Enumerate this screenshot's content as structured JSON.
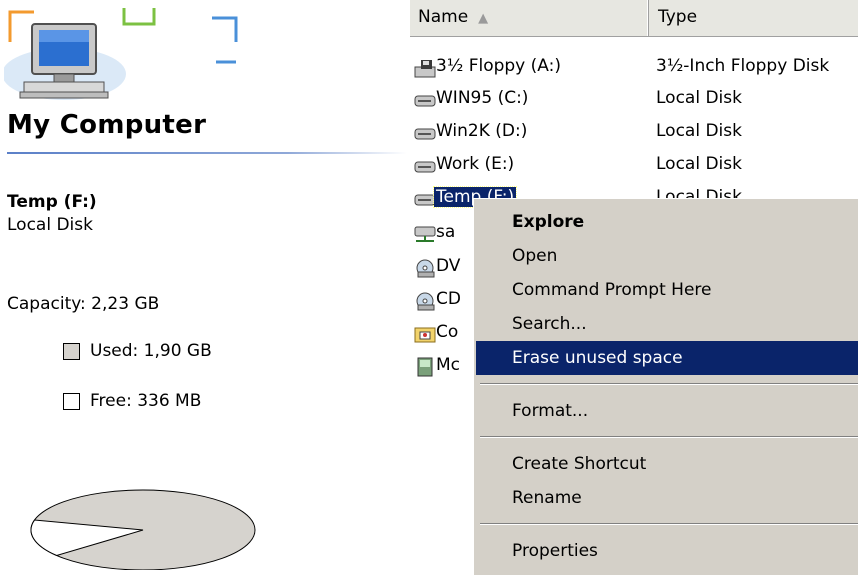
{
  "left_pane": {
    "title": "My Computer",
    "drive_name": "Temp (F:)",
    "drive_type": "Local Disk",
    "capacity": "Capacity: 2,23 GB",
    "used": "Used: 1,90 GB",
    "free": "Free: 336 MB",
    "used_fraction": 0.85,
    "colors": {
      "used": "#d6d3ce",
      "free": "#ffffff",
      "title_rule": "#5b80c8"
    }
  },
  "list": {
    "columns": {
      "name": "Name",
      "type": "Type",
      "sort_arrow": "▲"
    },
    "rows": [
      {
        "name": "3½ Floppy (A:)",
        "type": "3½-Inch Floppy Disk",
        "icon": "floppy-drive-icon"
      },
      {
        "name": "WIN95 (C:)",
        "type": "Local Disk",
        "icon": "hard-disk-icon"
      },
      {
        "name": "Win2K (D:)",
        "type": "Local Disk",
        "icon": "hard-disk-icon"
      },
      {
        "name": "Work (E:)",
        "type": "Local Disk",
        "icon": "hard-disk-icon"
      },
      {
        "name": "Temp (F:)",
        "type": "Local Disk",
        "icon": "hard-disk-icon",
        "selected": true
      },
      {
        "name": "sa",
        "type": "",
        "icon": "network-drive-icon"
      },
      {
        "name": "DV",
        "type": "",
        "icon": "cd-drive-icon"
      },
      {
        "name": "CD",
        "type": "",
        "icon": "cd-drive-icon"
      },
      {
        "name": "Co",
        "type": "",
        "icon": "control-panel-folder-icon"
      },
      {
        "name": "Mc",
        "type": "",
        "icon": "mobile-device-icon"
      }
    ]
  },
  "menu": {
    "explore": "Explore",
    "open": "Open",
    "command_prompt": "Command Prompt Here",
    "search": "Search...",
    "erase": "Erase unused space",
    "format": "Format...",
    "create_shortcut": "Create Shortcut",
    "rename": "Rename",
    "properties": "Properties",
    "colors": {
      "highlight": "#0a246a",
      "background": "#d4d0c8"
    }
  }
}
